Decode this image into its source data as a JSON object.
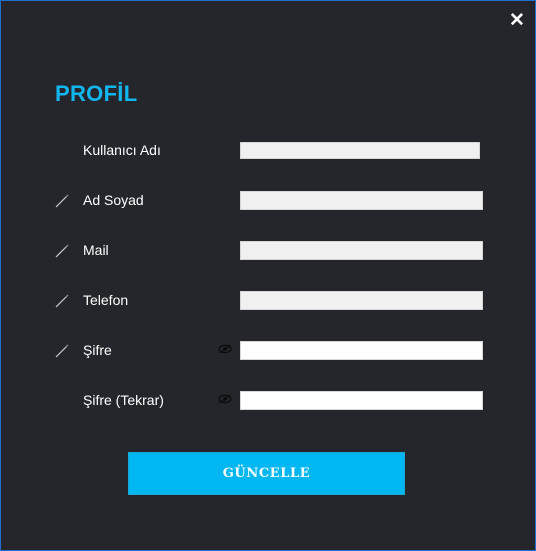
{
  "window": {
    "close_icon": "close-icon"
  },
  "title": "PROFİL",
  "fields": [
    {
      "label": "Kullanıcı Adı",
      "value": "",
      "editable_icon": false,
      "eye_icon": false
    },
    {
      "label": "Ad Soyad",
      "value": "",
      "editable_icon": true,
      "eye_icon": false
    },
    {
      "label": "Mail",
      "value": "",
      "editable_icon": true,
      "eye_icon": false
    },
    {
      "label": "Telefon",
      "value": "",
      "editable_icon": true,
      "eye_icon": false
    },
    {
      "label": "Şifre",
      "value": "",
      "editable_icon": true,
      "eye_icon": true
    },
    {
      "label": "Şifre (Tekrar)",
      "value": "",
      "editable_icon": false,
      "eye_icon": true
    }
  ],
  "update_button": "GÜNCELLE",
  "colors": {
    "background": "#24262b",
    "accent": "#00b7f1",
    "title": "#12b6ef",
    "border": "#1f6fd1"
  }
}
